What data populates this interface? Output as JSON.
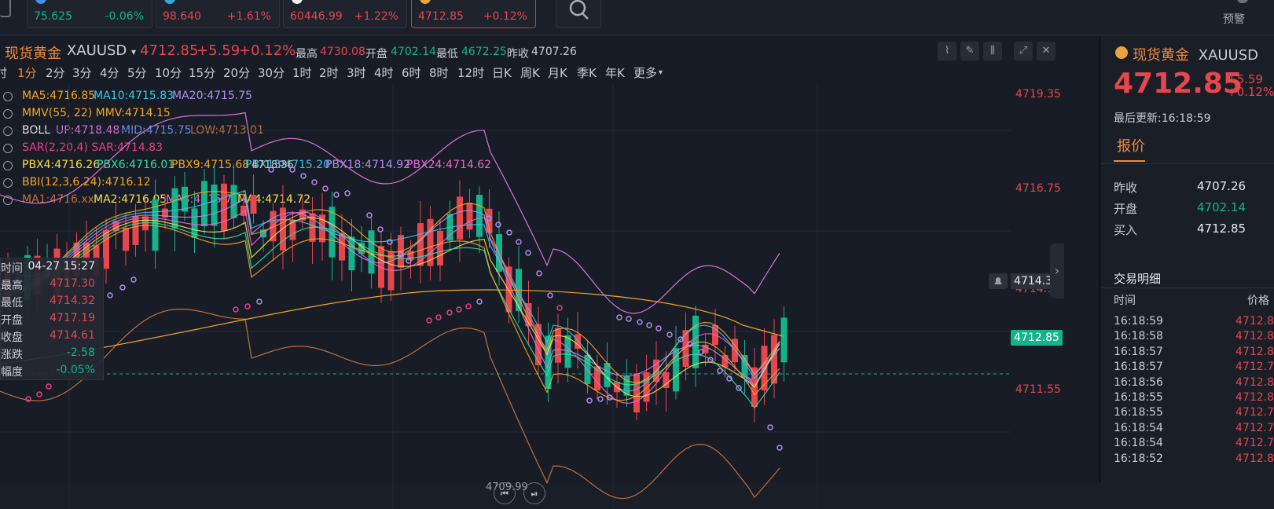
{
  "watchlist": [
    {
      "price": "75.625",
      "change": "-0.06%",
      "dir": "down",
      "dot_color": "#4a8ef0"
    },
    {
      "price": "98.640",
      "change": "+1.61%",
      "dir": "up",
      "dot_color": "#3aa3d8"
    },
    {
      "price": "60446.99",
      "change": "+1.22%",
      "dir": "up",
      "dot_color": "#f0f0f0"
    },
    {
      "price": "4712.85",
      "change": "+0.12%",
      "dir": "up",
      "dot_color": "#e8a33c"
    }
  ],
  "alarm_label": "预警",
  "symbol": {
    "name": "现货黄金",
    "code": "XAUUSD",
    "price": "4712.85",
    "change": "+5.59",
    "change_pct": "+0.12%",
    "high_label": "最高",
    "high": "4730.08",
    "open_label": "开盘",
    "open": "4702.14",
    "low_label": "最低",
    "low": "4672.25",
    "prev_label": "昨收",
    "prev": "4707.26"
  },
  "periods": [
    "时",
    "1分",
    "2分",
    "3分",
    "4分",
    "5分",
    "10分",
    "15分",
    "20分",
    "30分",
    "1时",
    "2时",
    "3时",
    "4时",
    "6时",
    "8时",
    "12时",
    "日K",
    "周K",
    "月K",
    "季K",
    "年K",
    "更多"
  ],
  "active_period": "1分",
  "indicators": [
    [
      {
        "t": "MA5:4716.85",
        "c": "#f5a623"
      },
      {
        "t": "MA10:4715.83",
        "c": "#35c8e6"
      },
      {
        "t": "MA20:4715.75",
        "c": "#b48cf0"
      }
    ],
    [
      {
        "t": "MMV(55, 22) MMV:4714.15",
        "c": "#f5a623"
      }
    ],
    [
      {
        "t": "BOLL",
        "c": "#e8eaee"
      },
      {
        "t": "UP:4718.48",
        "c": "#d574d5"
      },
      {
        "t": "MID:4715.75",
        "c": "#6e8ef0"
      },
      {
        "t": "LOW:4713.01",
        "c": "#c2703a"
      }
    ],
    [
      {
        "t": "SAR(2,20,4) SAR:4714.83",
        "c": "#e83e8c"
      }
    ],
    [
      {
        "t": "PBX4:4716.26",
        "c": "#f4e04a"
      },
      {
        "t": "PBX6:4716.01",
        "c": "#35e0a0"
      },
      {
        "t": "PBX9:4715.68",
        "c": "#f5a623"
      },
      {
        "t": "PBX13:4715.20",
        "c": "#35c8e6"
      },
      {
        "t": "PBX18:4714.92",
        "c": "#b48cf0"
      },
      {
        "t": "PBX24:4714.62",
        "c": "#e86ad0"
      }
    ],
    [
      {
        "t": "BBI(12,3,6,24):4716.12",
        "c": "#f5a623"
      }
    ],
    [
      {
        "t": "MA1:4716.xx",
        "c": "#c2703a"
      },
      {
        "t": "MA2:4716.05",
        "c": "#f4e04a"
      },
      {
        "t": "MA3:4715.71",
        "c": "#e86ad0"
      },
      {
        "t": "MA4:4714.72",
        "c": "#f4e04a"
      }
    ]
  ],
  "tooltip": {
    "time_label": "时间",
    "time": "04-27 15:27",
    "rows": [
      {
        "label": "最高",
        "value": "4717.30",
        "dir": "up"
      },
      {
        "label": "最低",
        "value": "4714.32",
        "dir": "up"
      },
      {
        "label": "开盘",
        "value": "4717.19",
        "dir": "up"
      },
      {
        "label": "收盘",
        "value": "4714.61",
        "dir": "up"
      },
      {
        "label": "涨跌",
        "value": "-2.58",
        "dir": "down"
      },
      {
        "label": "幅度",
        "value": "-0.05%",
        "dir": "down"
      }
    ]
  },
  "price_axis": [
    "4719.35",
    "4716.75",
    "4714.15",
    "4711.55"
  ],
  "current_price_tag": "4712.85",
  "crosshair_price_tag": "4714.31",
  "chart_marks": {
    "high": "4718.36",
    "low": "4709.99"
  },
  "sidebar": {
    "name": "现货黄金",
    "code": "XAUUSD",
    "price": "4712.85",
    "change": "+5.59",
    "change_pct": "+0.12%",
    "update_label": "最后更新:16:18:59",
    "tab": "报价",
    "quote_rows": [
      {
        "label": "昨收",
        "value": "4707.26",
        "dir": "neutral"
      },
      {
        "label": "开盘",
        "value": "4702.14",
        "dir": "down"
      },
      {
        "label": "买入",
        "value": "4712.85",
        "dir": "neutral"
      }
    ],
    "trades_title": "交易明细",
    "trades_time_header": "时间",
    "trades_price_header": "价格",
    "trades": [
      {
        "time": "16:18:59",
        "price": "4712.8"
      },
      {
        "time": "16:18:58",
        "price": "4712.8"
      },
      {
        "time": "16:18:57",
        "price": "4712.8"
      },
      {
        "time": "16:18:57",
        "price": "4712.7"
      },
      {
        "time": "16:18:56",
        "price": "4712.8"
      },
      {
        "time": "16:18:55",
        "price": "4712.8"
      },
      {
        "time": "16:18:55",
        "price": "4712.7"
      },
      {
        "time": "16:18:54",
        "price": "4712.7"
      },
      {
        "time": "16:18:54",
        "price": "4712.7"
      },
      {
        "time": "16:18:52",
        "price": "4712.8"
      }
    ]
  }
}
